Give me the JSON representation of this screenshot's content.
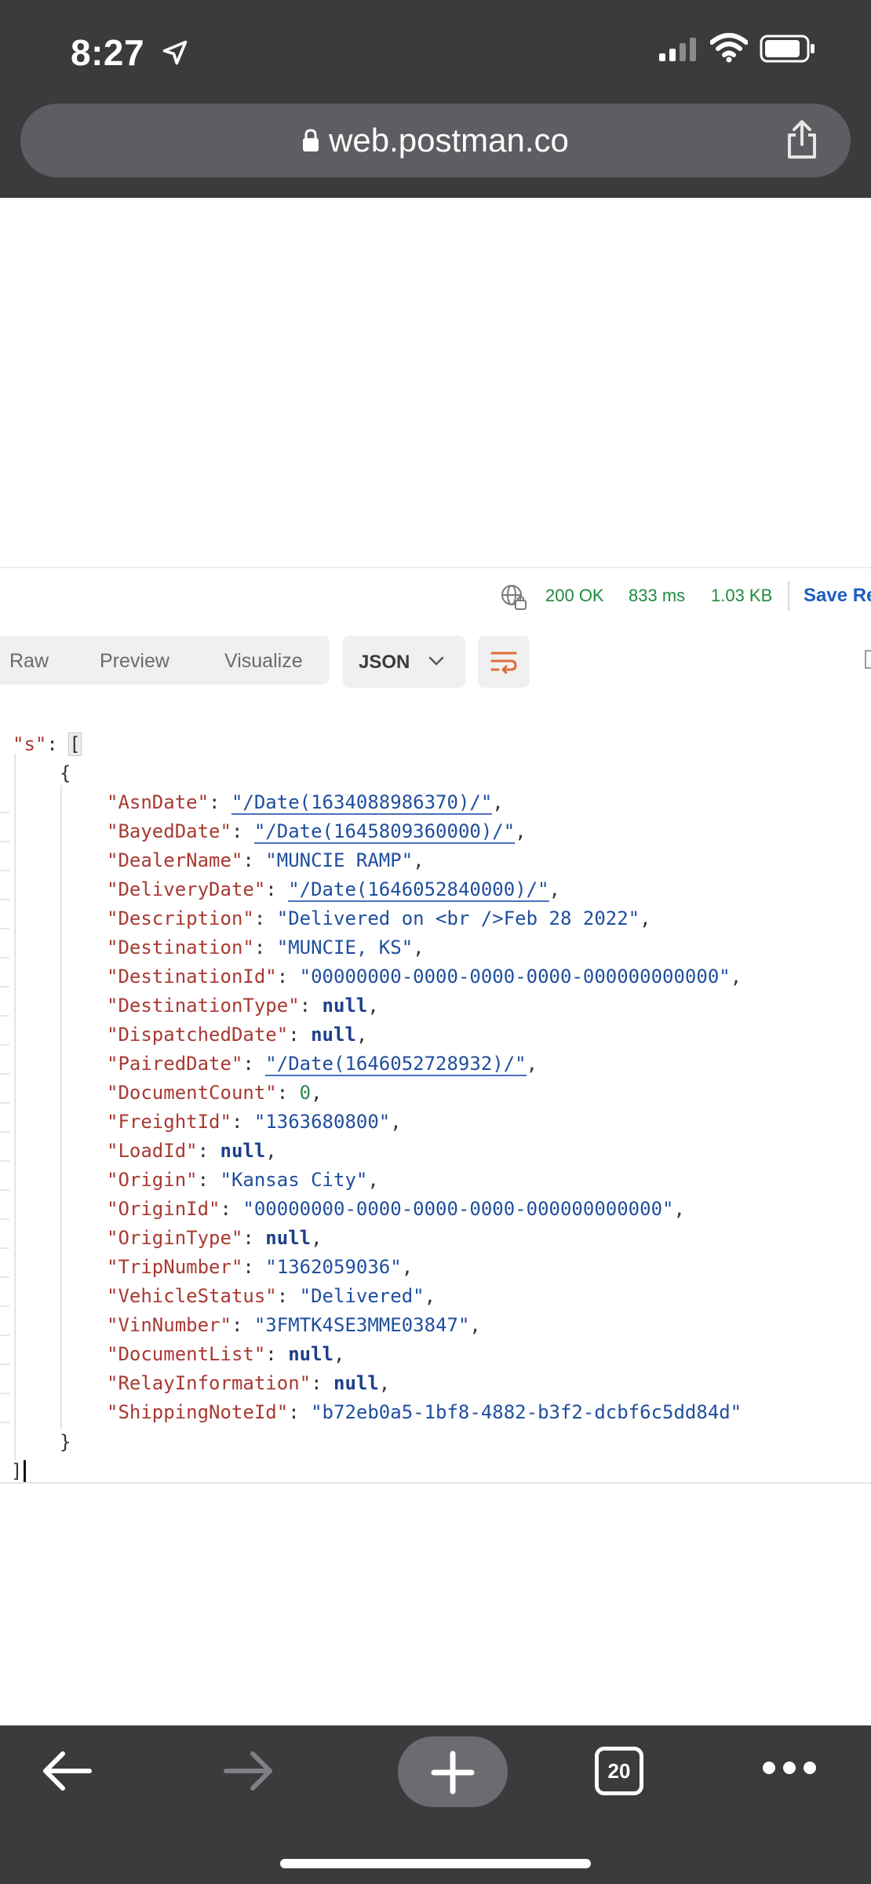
{
  "status_bar": {
    "time": "8:27",
    "location_icon": "location-arrow-icon",
    "signal_icon": "cellular-signal-icon",
    "wifi_icon": "wifi-icon",
    "battery_icon": "battery-icon"
  },
  "browser": {
    "url": "web.postman.co",
    "lock_icon": "lock-icon",
    "share_icon": "share-icon"
  },
  "response_meta": {
    "globe_icon": "globe-lock-icon",
    "status": "200 OK",
    "time": "833 ms",
    "size": "1.03 KB",
    "save_label": "Save Re"
  },
  "tabs": {
    "raw": "Raw",
    "preview": "Preview",
    "visualize": "Visualize",
    "format": "JSON",
    "wrap_icon": "wrap-lines-icon"
  },
  "json_view": {
    "open_key": "\"s\"",
    "colon": ": ",
    "open_bracket": "[",
    "open_brace": "{",
    "close_brace": "}",
    "close_bracket": "]",
    "rows": [
      {
        "key": "\"AsnDate\"",
        "value": "\"/Date(1634088986370)/\"",
        "kind": "link"
      },
      {
        "key": "\"BayedDate\"",
        "value": "\"/Date(1645809360000)/\"",
        "kind": "link"
      },
      {
        "key": "\"DealerName\"",
        "value": "\"MUNCIE RAMP\"",
        "kind": "string"
      },
      {
        "key": "\"DeliveryDate\"",
        "value": "\"/Date(1646052840000)/\"",
        "kind": "link"
      },
      {
        "key": "\"Description\"",
        "value": "\"Delivered on <br />Feb 28 2022\"",
        "kind": "string"
      },
      {
        "key": "\"Destination\"",
        "value": "\"MUNCIE, KS\"",
        "kind": "string"
      },
      {
        "key": "\"DestinationId\"",
        "value": "\"00000000-0000-0000-0000-000000000000\"",
        "kind": "string"
      },
      {
        "key": "\"DestinationType\"",
        "value": "null",
        "kind": "null"
      },
      {
        "key": "\"DispatchedDate\"",
        "value": "null",
        "kind": "null"
      },
      {
        "key": "\"PairedDate\"",
        "value": "\"/Date(1646052728932)/\"",
        "kind": "link"
      },
      {
        "key": "\"DocumentCount\"",
        "value": "0",
        "kind": "number"
      },
      {
        "key": "\"FreightId\"",
        "value": "\"1363680800\"",
        "kind": "string"
      },
      {
        "key": "\"LoadId\"",
        "value": "null",
        "kind": "null"
      },
      {
        "key": "\"Origin\"",
        "value": "\"Kansas City\"",
        "kind": "string"
      },
      {
        "key": "\"OriginId\"",
        "value": "\"00000000-0000-0000-0000-000000000000\"",
        "kind": "string"
      },
      {
        "key": "\"OriginType\"",
        "value": "null",
        "kind": "null"
      },
      {
        "key": "\"TripNumber\"",
        "value": "\"1362059036\"",
        "kind": "string"
      },
      {
        "key": "\"VehicleStatus\"",
        "value": "\"Delivered\"",
        "kind": "string"
      },
      {
        "key": "\"VinNumber\"",
        "value": "\"3FMTK4SE3MME03847\"",
        "kind": "string"
      },
      {
        "key": "\"DocumentList\"",
        "value": "null",
        "kind": "null"
      },
      {
        "key": "\"RelayInformation\"",
        "value": "null",
        "kind": "null"
      },
      {
        "key": "\"ShippingNoteId\"",
        "value": "\"b72eb0a5-1bf8-4882-b3f2-dcbf6c5dd84d\"",
        "kind": "string"
      }
    ]
  },
  "bottom_bar": {
    "back_icon": "back-arrow-icon",
    "forward_icon": "forward-arrow-icon",
    "new_tab_icon": "plus-icon",
    "tab_count": "20",
    "more_icon": "more-dots-icon"
  }
}
